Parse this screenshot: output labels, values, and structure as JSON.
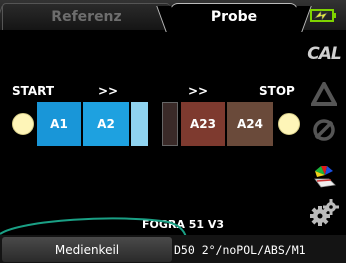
{
  "tabs": {
    "reference_label": "Referenz",
    "sample_label": "Probe"
  },
  "strip": {
    "start_label": "START",
    "stop_label": "STOP",
    "arrow_left": ">>",
    "arrow_right": ">>",
    "patches": [
      {
        "label": "A1",
        "color": "#1996d8"
      },
      {
        "label": "A2",
        "color": "#1ea1e0"
      },
      {
        "label": "",
        "color": "#8fd3f0"
      },
      {
        "label": "",
        "color": "#3a2a28"
      },
      {
        "label": "A23",
        "color": "#7e3a2f"
      },
      {
        "label": "A24",
        "color": "#6a4a3a"
      }
    ]
  },
  "reference_name": "FOGRA 51 V3",
  "bottom": {
    "medienkeil_label": "Medienkeil",
    "settings": "D50 2°/noPOL/ABS/M1"
  },
  "sidebar": {
    "cal_label": "CAL"
  },
  "colors": {
    "accent_green": "#7fd400",
    "swoosh": "#1aa085"
  }
}
